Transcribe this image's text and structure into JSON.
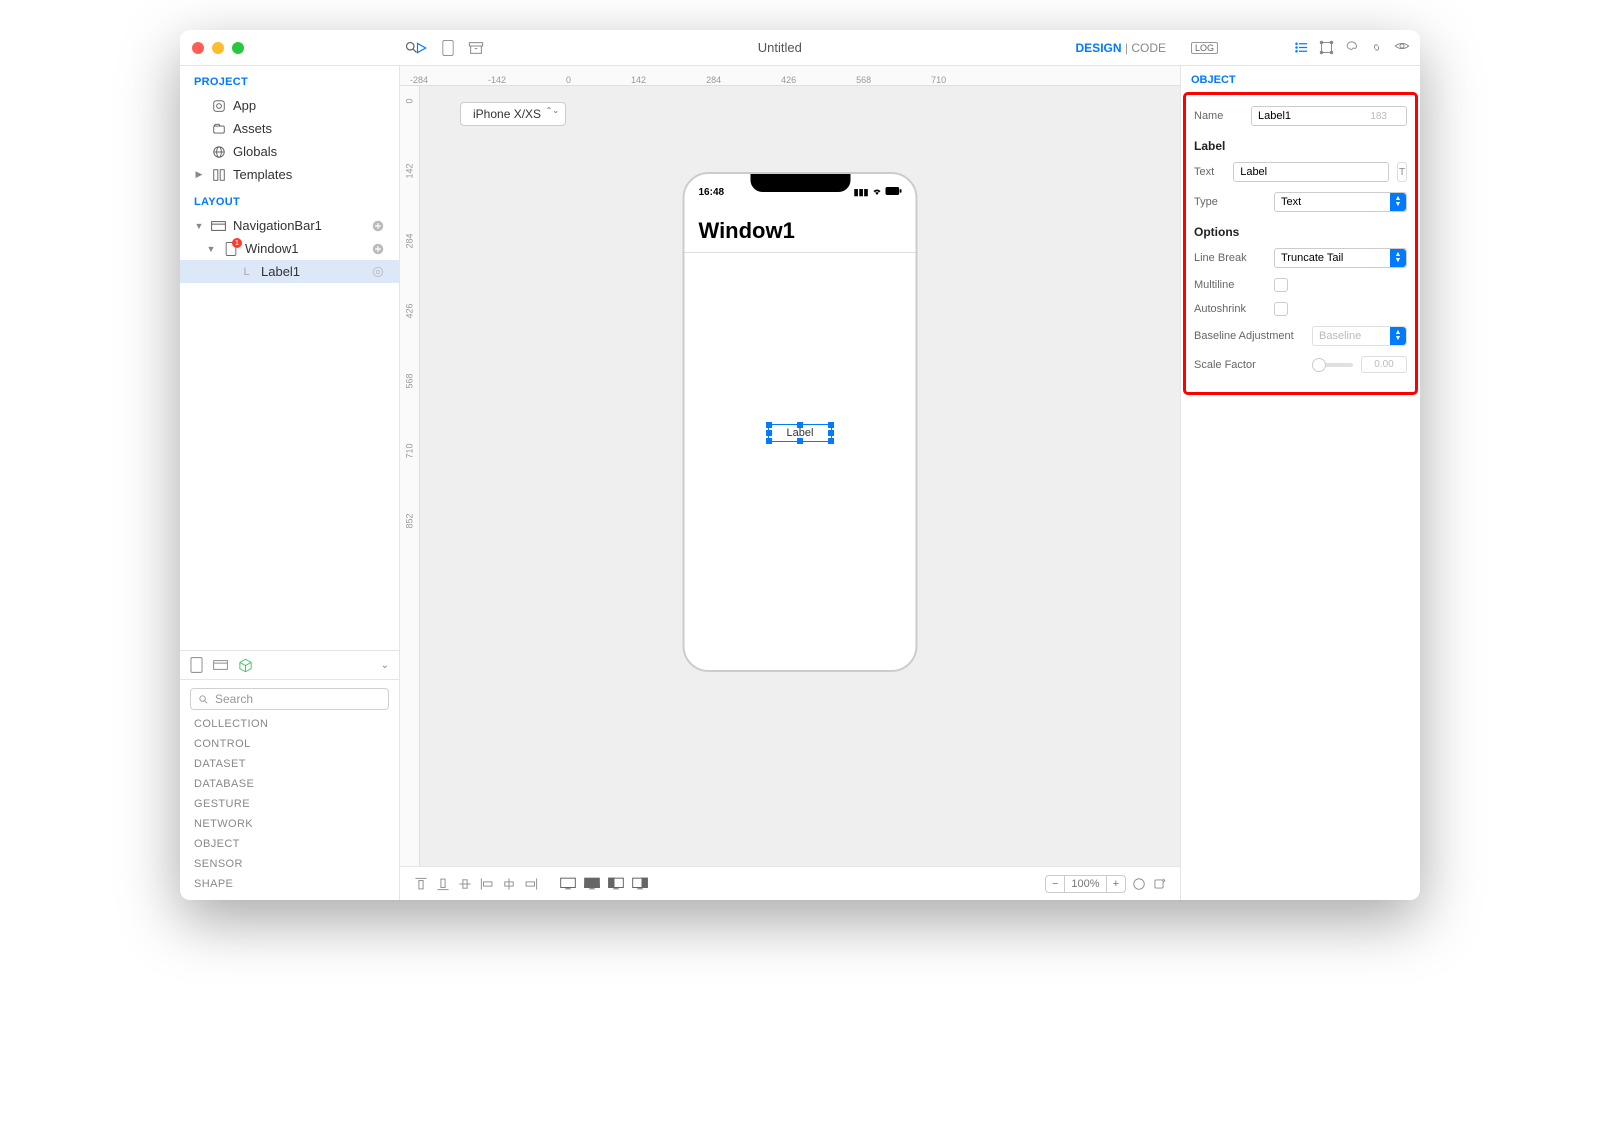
{
  "title": "Untitled",
  "tabs": {
    "design": "DESIGN",
    "code": "CODE"
  },
  "sidebar": {
    "project_h": "PROJECT",
    "layout_h": "LAYOUT",
    "project": [
      {
        "label": "App"
      },
      {
        "label": "Assets"
      },
      {
        "label": "Globals"
      },
      {
        "label": "Templates"
      }
    ],
    "layout": {
      "nav": "NavigationBar1",
      "win": "Window1",
      "label": "Label1",
      "badge": "1"
    }
  },
  "palette": {
    "search_ph": "Search",
    "cats": [
      "COLLECTION",
      "CONTROL",
      "DATASET",
      "DATABASE",
      "GESTURE",
      "NETWORK",
      "OBJECT",
      "SENSOR",
      "SHAPE"
    ]
  },
  "device": {
    "selected": "iPhone X/XS"
  },
  "phone": {
    "time": "16:48",
    "nav_title": "Window1",
    "label": "Label"
  },
  "ruler": [
    "-284",
    "-142",
    "0",
    "142",
    "284",
    "426",
    "568",
    "710"
  ],
  "vruler": [
    "0",
    "142",
    "284",
    "426",
    "568",
    "710",
    "852"
  ],
  "zoom": "100%",
  "inspector": {
    "header": "OBJECT",
    "name_lbl": "Name",
    "name_val": "Label1",
    "name_suffix": "183",
    "label_h": "Label",
    "text_lbl": "Text",
    "text_val": "Label",
    "type_lbl": "Type",
    "type_val": "Text",
    "options_h": "Options",
    "lb_lbl": "Line Break",
    "lb_val": "Truncate Tail",
    "ml_lbl": "Multiline",
    "as_lbl": "Autoshrink",
    "ba_lbl": "Baseline Adjustment",
    "ba_val": "Baseline",
    "sf_lbl": "Scale Factor",
    "sf_val": "0.00"
  },
  "log": "LOG"
}
